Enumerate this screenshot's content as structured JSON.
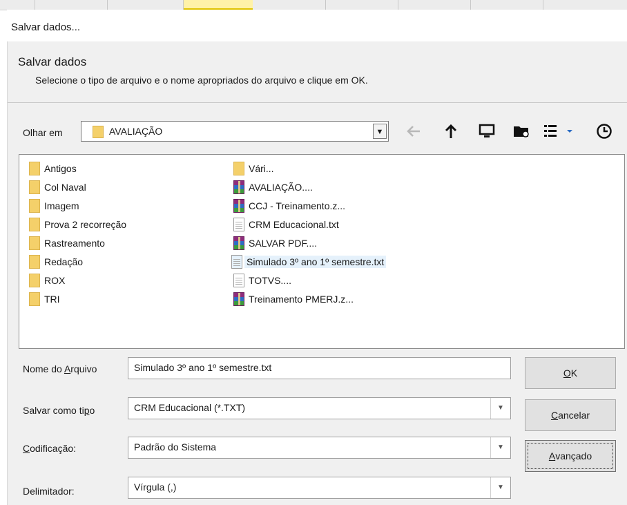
{
  "window": {
    "title": "Salvar dados..."
  },
  "header": {
    "title": "Salvar dados",
    "subtitle": "Selecione o tipo de arquivo e o nome apropriados do arquivo e clique em OK."
  },
  "lookin": {
    "label": "Olhar em",
    "value": "AVALIAÇÃO",
    "toolbar_icons": [
      "back-arrow-icon",
      "up-arrow-icon",
      "desktop-icon",
      "new-folder-icon",
      "view-menu-icon",
      "recent-icon"
    ]
  },
  "files": {
    "col1": [
      {
        "name": "Antigos",
        "icon": "folder-icon"
      },
      {
        "name": "Col Naval",
        "icon": "folder-icon"
      },
      {
        "name": "Imagem",
        "icon": "folder-icon"
      },
      {
        "name": "Prova 2 recorreção",
        "icon": "folder-icon"
      },
      {
        "name": "Rastreamento",
        "icon": "folder-icon"
      },
      {
        "name": "Redação",
        "icon": "folder-icon"
      },
      {
        "name": "ROX",
        "icon": "folder-icon"
      },
      {
        "name": "TRI",
        "icon": "folder-icon"
      }
    ],
    "col2": [
      {
        "name": "Vári...",
        "icon": "folder-icon"
      },
      {
        "name": "AVALIAÇÃO....",
        "icon": "rar-archive-icon"
      },
      {
        "name": "CCJ - Treinamento.z...",
        "icon": "rar-archive-icon"
      },
      {
        "name": "CRM Educacional.txt",
        "icon": "text-file-icon"
      },
      {
        "name": "SALVAR PDF....",
        "icon": "rar-archive-icon"
      },
      {
        "name": "Simulado 3º ano 1º semestre.txt",
        "icon": "text-file-icon",
        "selected": true
      },
      {
        "name": "TOTVS....",
        "icon": "text-file-icon"
      },
      {
        "name": "Treinamento PMERJ.z...",
        "icon": "rar-archive-icon"
      }
    ]
  },
  "form": {
    "filename": {
      "label_pre": "Nome do ",
      "label_u": "A",
      "label_post": "rquivo",
      "value": "Simulado 3º ano 1º semestre.txt"
    },
    "filetype": {
      "label_pre": "Salvar como ti",
      "label_u": "p",
      "label_post": "o",
      "value": "CRM Educacional (*.TXT)"
    },
    "encoding": {
      "label_pre": "",
      "label_u": "C",
      "label_post": "odificação:",
      "value": "Padrão do Sistema"
    },
    "delimiter": {
      "label": "Delimitador:",
      "value": "Vírgula (,)"
    }
  },
  "buttons": {
    "ok": {
      "u": "O",
      "rest": "K"
    },
    "cancel": {
      "u": "C",
      "rest": "ancelar"
    },
    "advanced": {
      "u": "A",
      "rest": "vançado"
    }
  }
}
